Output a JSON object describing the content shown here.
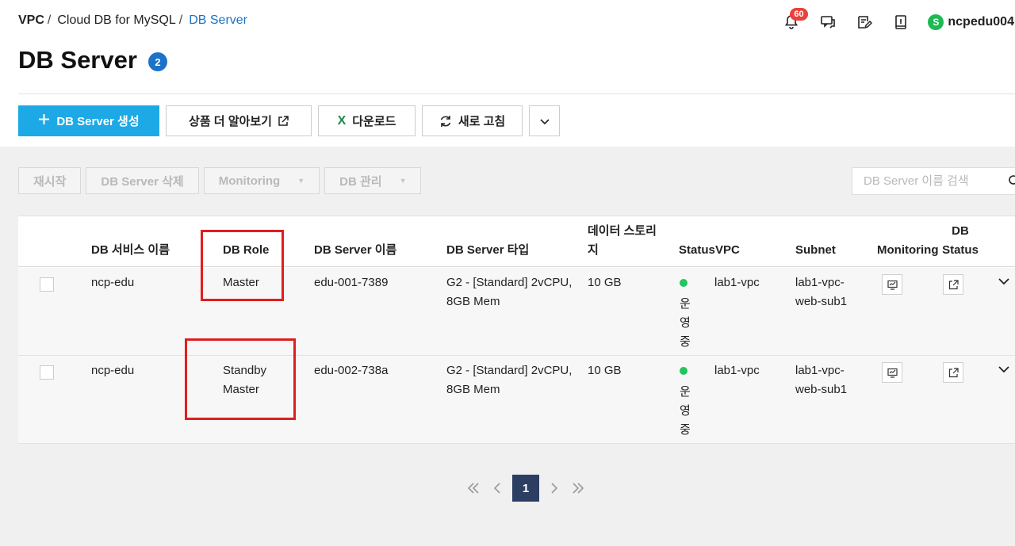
{
  "breadcrumb": {
    "items": [
      "VPC",
      "Cloud DB for MySQL",
      "DB Server"
    ],
    "separator": "/"
  },
  "header": {
    "notification_count": "60",
    "username": "ncpedu004",
    "avatar_letter": "S",
    "caret": "▾"
  },
  "page": {
    "title": "DB Server",
    "count": "2"
  },
  "toolbar": {
    "create_label": "DB Server 생성",
    "learn_more_label": "상품 더 알아보기",
    "download_label": "다운로드",
    "refresh_label": "새로 고침"
  },
  "actions": {
    "restart_label": "재시작",
    "delete_label": "DB Server 삭제",
    "monitoring_label": "Monitoring",
    "db_manage_label": "DB 관리"
  },
  "search": {
    "placeholder": "DB Server 이름 검색"
  },
  "table": {
    "headers": {
      "service_name": "DB 서비스 이름",
      "db_role": "DB Role",
      "server_name": "DB Server 이름",
      "server_type": "DB Server 타입",
      "storage": "데이터 스토리지",
      "status": "Status",
      "vpc": "VPC",
      "subnet": "Subnet",
      "monitoring": "Monitoring",
      "db_status": "DB Status"
    },
    "rows": [
      {
        "service_name": "ncp-edu",
        "db_role": "Master",
        "server_name": "edu-001-7389",
        "server_type": "G2 - [Standard] 2vCPU, 8GB Mem",
        "storage": "10 GB",
        "status": "운영중",
        "vpc": "lab1-vpc",
        "subnet": "lab1-vpc-web-sub1"
      },
      {
        "service_name": "ncp-edu",
        "db_role": "Standby Master",
        "server_name": "edu-002-738a",
        "server_type": "G2 - [Standard] 2vCPU, 8GB Mem",
        "storage": "10 GB",
        "status": "운영중",
        "vpc": "lab1-vpc",
        "subnet": "lab1-vpc-web-sub1"
      }
    ]
  },
  "pagination": {
    "current": "1"
  },
  "colors": {
    "primary": "#1da9e6",
    "link": "#1a73c9",
    "status_running": "#22c55e",
    "annotation": "#e01e1e",
    "page_active": "#2d3e63"
  }
}
